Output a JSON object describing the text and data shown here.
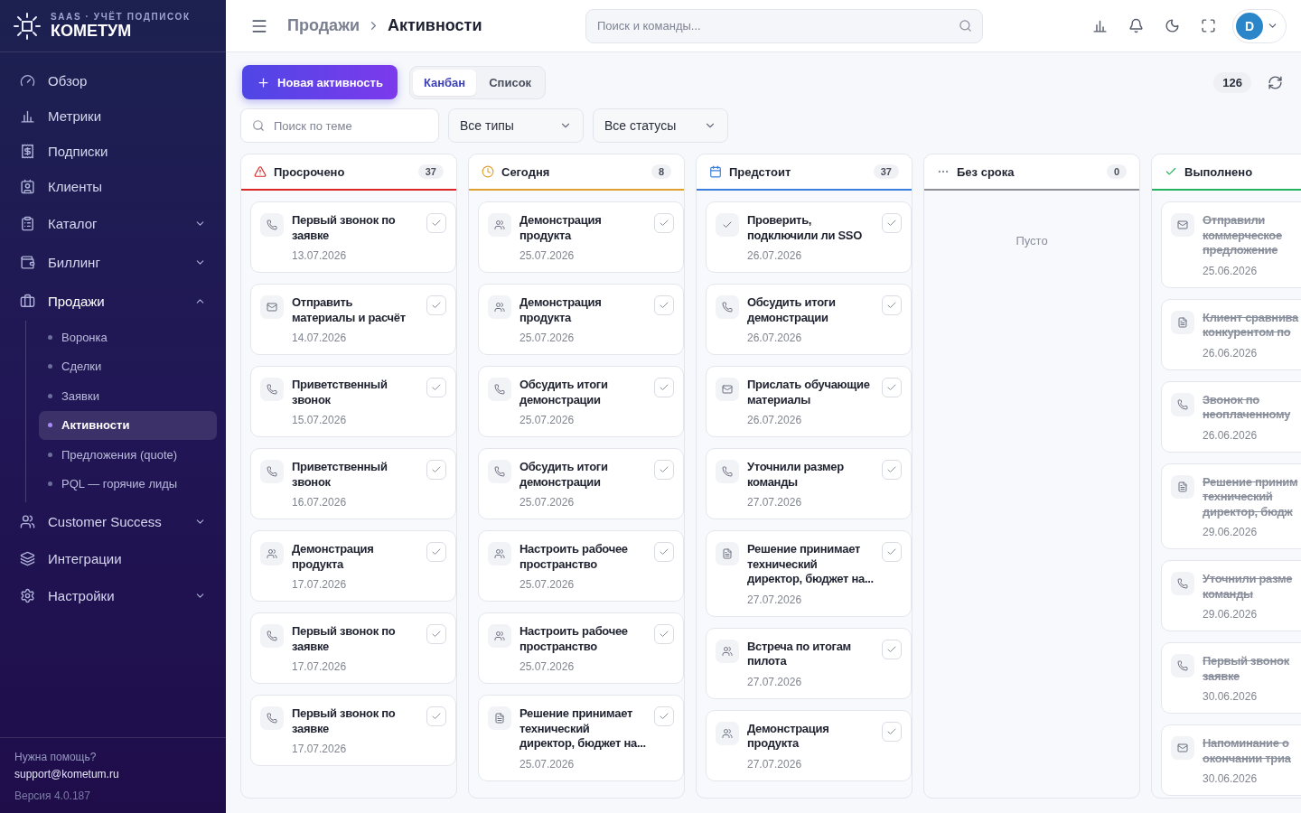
{
  "sidebar": {
    "brand": {
      "tagline": "SAAS · УЧЁТ ПОДПИСОК",
      "name": "КОМЕТУМ"
    },
    "items": [
      {
        "label": "Обзор",
        "kind": "gauge",
        "expandable": false,
        "expanded": false
      },
      {
        "label": "Метрики",
        "kind": "chart",
        "expandable": false,
        "expanded": false
      },
      {
        "label": "Подписки",
        "kind": "receipt",
        "expandable": false,
        "expanded": false
      },
      {
        "label": "Клиенты",
        "kind": "idcard",
        "expandable": false,
        "expanded": false
      },
      {
        "label": "Каталог",
        "kind": "clipboard",
        "expandable": true,
        "expanded": false
      },
      {
        "label": "Биллинг",
        "kind": "wallet",
        "expandable": true,
        "expanded": false
      },
      {
        "label": "Продажи",
        "kind": "briefcase",
        "expandable": true,
        "expanded": true,
        "children": [
          {
            "label": "Воронка",
            "selected": false
          },
          {
            "label": "Сделки",
            "selected": false
          },
          {
            "label": "Заявки",
            "selected": false
          },
          {
            "label": "Активности",
            "selected": true
          },
          {
            "label": "Предложения (quote)",
            "selected": false
          },
          {
            "label": "PQL — горячие лиды",
            "selected": false
          }
        ]
      },
      {
        "label": "Customer Success",
        "kind": "users",
        "expandable": true,
        "expanded": false
      },
      {
        "label": "Интеграции",
        "kind": "layers",
        "expandable": false,
        "expanded": false
      },
      {
        "label": "Настройки",
        "kind": "settings",
        "expandable": true,
        "expanded": false
      }
    ],
    "footer": {
      "help": "Нужна помощь?",
      "email": "support@kometum.ru",
      "version": "Версия 4.0.187"
    }
  },
  "topbar": {
    "breadcrumb": [
      "Продажи",
      "Активности"
    ],
    "search": {
      "placeholder": "Поиск и команды..."
    },
    "avatar": "D"
  },
  "toolbar": {
    "new_button": "Новая активность",
    "views": [
      {
        "label": "Канбан",
        "selected": true
      },
      {
        "label": "Список",
        "selected": false
      }
    ],
    "total": "126",
    "search": {
      "placeholder": "Поиск по теме"
    },
    "filters": [
      "Все типы",
      "Все статусы"
    ]
  },
  "columns": [
    {
      "kind": "overdue",
      "title": "Просрочено",
      "count": "37",
      "color": "#dc2626",
      "cards": [
        {
          "kind": "call",
          "title": "Первый звонок по заявке",
          "date": "13.07.2026",
          "done": false
        },
        {
          "kind": "mail",
          "title": "Отправить материалы и расчёт",
          "date": "14.07.2026",
          "done": false
        },
        {
          "kind": "call",
          "title": "Приветственный звонок",
          "date": "15.07.2026",
          "done": false
        },
        {
          "kind": "call",
          "title": "Приветственный звонок",
          "date": "16.07.2026",
          "done": false
        },
        {
          "kind": "meeting",
          "title": "Демонстрация продукта",
          "date": "17.07.2026",
          "done": false
        },
        {
          "kind": "call",
          "title": "Первый звонок по заявке",
          "date": "17.07.2026",
          "done": false
        },
        {
          "kind": "call",
          "title": "Первый звонок по заявке",
          "date": "17.07.2026",
          "done": false
        }
      ]
    },
    {
      "kind": "today",
      "title": "Сегодня",
      "count": "8",
      "color": "#e0a030",
      "cards": [
        {
          "kind": "meeting",
          "title": "Демонстрация продукта",
          "date": "25.07.2026",
          "done": false
        },
        {
          "kind": "meeting",
          "title": "Демонстрация продукта",
          "date": "25.07.2026",
          "done": false
        },
        {
          "kind": "call",
          "title": "Обсудить итоги демонстрации",
          "date": "25.07.2026",
          "done": false
        },
        {
          "kind": "call",
          "title": "Обсудить итоги демонстрации",
          "date": "25.07.2026",
          "done": false
        },
        {
          "kind": "meeting",
          "title": "Настроить рабочее пространство",
          "date": "25.07.2026",
          "done": false
        },
        {
          "kind": "meeting",
          "title": "Настроить рабочее пространство",
          "date": "25.07.2026",
          "done": false
        },
        {
          "kind": "doc",
          "title": "Решение принимает технический директор, бюджет на...",
          "date": "25.07.2026",
          "done": false
        }
      ]
    },
    {
      "kind": "upcoming",
      "title": "Предстоит",
      "count": "37",
      "color": "#3b7ddd",
      "cards": [
        {
          "kind": "task",
          "title": "Проверить, подключили ли SSO",
          "date": "26.07.2026",
          "done": false
        },
        {
          "kind": "call",
          "title": "Обсудить итоги демонстрации",
          "date": "26.07.2026",
          "done": false
        },
        {
          "kind": "mail",
          "title": "Прислать обучающие материалы",
          "date": "26.07.2026",
          "done": false
        },
        {
          "kind": "call",
          "title": "Уточнили размер команды",
          "date": "27.07.2026",
          "done": false
        },
        {
          "kind": "doc",
          "title": "Решение принимает технический директор, бюджет на...",
          "date": "27.07.2026",
          "done": false
        },
        {
          "kind": "meeting",
          "title": "Встреча по итогам пилота",
          "date": "27.07.2026",
          "done": false
        },
        {
          "kind": "meeting",
          "title": "Демонстрация продукта",
          "date": "27.07.2026",
          "done": false
        }
      ]
    },
    {
      "kind": "none",
      "title": "Без срока",
      "count": "0",
      "color": "#8a8f98",
      "empty": "Пусто"
    },
    {
      "kind": "done",
      "title": "Выполнено",
      "color": "#22b35e",
      "cards": [
        {
          "kind": "mail",
          "title": "Отправили\nкоммерческое\nпредложение",
          "date": "25.06.2026",
          "done": true
        },
        {
          "kind": "doc",
          "title": "Клиент сравнива\nконкурентом по",
          "date": "26.06.2026",
          "done": true
        },
        {
          "kind": "call",
          "title": "Звонок по\nнеоплаченному",
          "date": "26.06.2026",
          "done": true
        },
        {
          "kind": "doc",
          "title": "Решение приним\nтехнический\nдиректор, бюдж",
          "date": "29.06.2026",
          "done": true
        },
        {
          "kind": "call",
          "title": "Уточнили разме\nкоманды",
          "date": "29.06.2026",
          "done": true
        },
        {
          "kind": "call",
          "title": "Первый звонок\nзаявке",
          "date": "30.06.2026",
          "done": true
        },
        {
          "kind": "mail",
          "title": "Напоминание о\nокончании триа",
          "date": "30.06.2026",
          "done": true
        }
      ]
    }
  ]
}
